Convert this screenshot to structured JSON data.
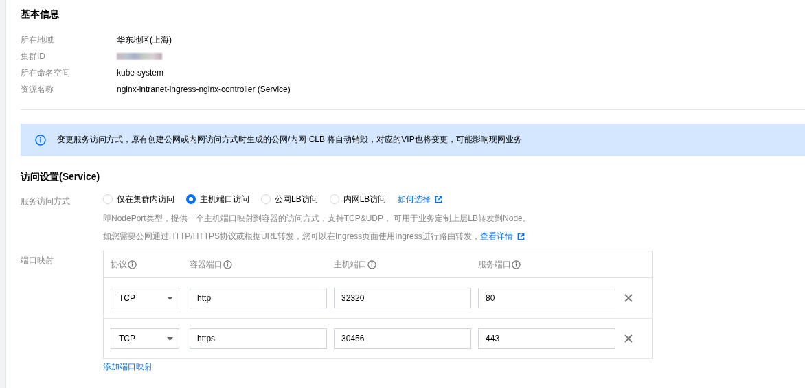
{
  "basic_info": {
    "title": "基本信息",
    "rows": [
      {
        "kind": "text",
        "label": "所在地域",
        "value": "华东地区(上海)"
      },
      {
        "kind": "redacted",
        "label": "集群ID"
      },
      {
        "kind": "text",
        "label": "所在命名空间",
        "value": "kube-system"
      },
      {
        "kind": "text",
        "label": "资源名称",
        "value": "nginx-intranet-ingress-nginx-controller (Service)"
      }
    ]
  },
  "alert": {
    "text": "变更服务访问方式，原有创建公网或内网访问方式时生成的公网/内网 CLB 将自动销毁，对应的VIP也将变更，可能影响现网业务"
  },
  "access_settings": {
    "title": "访问设置(Service)",
    "access_mode": {
      "label": "服务访问方式",
      "options": [
        {
          "label": "仅在集群内访问",
          "selected": false
        },
        {
          "label": "主机端口访问",
          "selected": true
        },
        {
          "label": "公网LB访问",
          "selected": false
        },
        {
          "label": "内网LB访问",
          "selected": false
        }
      ],
      "help_link": "如何选择",
      "description": "即NodePort类型，提供一个主机端口映射到容器的访问方式，支持TCP&UDP， 可用于业务定制上层LB转发到Node。",
      "note": "如您需要公网通过HTTP/HTTPS协议或根据URL转发，您可以在Ingress页面使用Ingress进行路由转发，",
      "note_link": "查看详情"
    },
    "port_mapping": {
      "label": "端口映射",
      "columns": [
        "协议",
        "容器端口",
        "主机端口",
        "服务端口"
      ],
      "rows": [
        {
          "protocol": "TCP",
          "container_port": "http",
          "host_port": "32320",
          "service_port": "80"
        },
        {
          "protocol": "TCP",
          "container_port": "https",
          "host_port": "30456",
          "service_port": "443"
        }
      ],
      "add_link": "添加端口映射"
    }
  }
}
